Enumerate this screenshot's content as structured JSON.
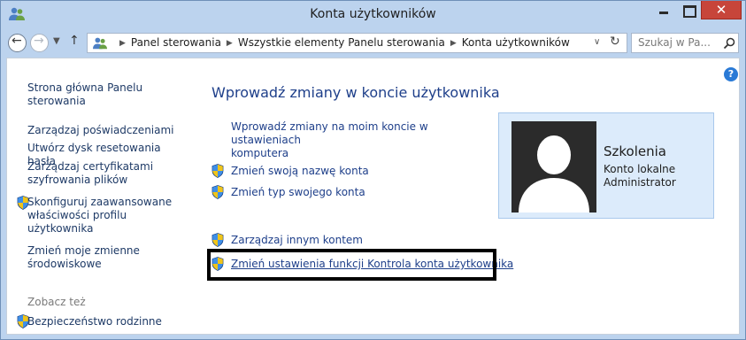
{
  "window": {
    "title": "Konta użytkowników",
    "close_glyph": "✕"
  },
  "nav": {
    "breadcrumbs": [
      "Panel sterowania",
      "Wszystkie elementy Panelu sterowania",
      "Konta użytkowników"
    ],
    "search_placeholder": "Szukaj w Pa..."
  },
  "sidebar": {
    "home_line1": "Strona główna Panelu",
    "home_line2": "sterowania",
    "items": [
      {
        "line1": "Zarządzaj poświadczeniami"
      },
      {
        "line1": "Utwórz dysk resetowania hasła"
      },
      {
        "line1": "Zarządzaj certyfikatami",
        "line2": "szyfrowania plików"
      },
      {
        "line1": "Skonfiguruj zaawansowane",
        "line2": "właściwości profilu",
        "line3": "użytkownika"
      },
      {
        "line1": "Zmień moje zmienne",
        "line2": "środowiskowe"
      }
    ],
    "see_also_heading": "Zobacz też",
    "see_also_link": "Bezpieczeństwo rodzinne"
  },
  "main": {
    "title": "Wprowadź zmiany w koncie użytkownika",
    "link_settings_line1": "Wprowadź zmiany na moim koncie w ustawieniach",
    "link_settings_line2": "komputera",
    "link_change_name": "Zmień swoją nazwę konta",
    "link_change_type": "Zmień typ swojego konta",
    "link_manage_other": "Zarządzaj innym kontem",
    "link_uac": "Zmień ustawienia funkcji Kontrola konta użytkownika"
  },
  "user": {
    "name": "Szkolenia",
    "account_type": "Konto lokalne",
    "role": "Administrator"
  },
  "colors": {
    "link": "#1e3f8a",
    "title_bar": "#bcd3ee",
    "close_button": "#c7453a",
    "user_card": "#dcebfb",
    "highlight_border": "#000000"
  },
  "icons": [
    "users-icon",
    "back-icon",
    "forward-icon",
    "up-icon",
    "refresh-icon",
    "search-icon",
    "help-icon",
    "uac-shield-icon",
    "avatar-silhouette"
  ]
}
